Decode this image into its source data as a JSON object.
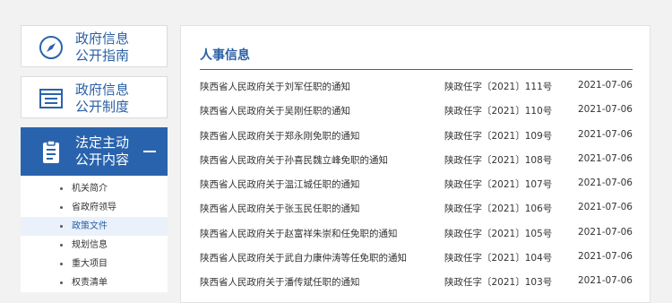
{
  "sidebar": {
    "cards": [
      {
        "line1": "政府信息",
        "line2": "公开指南",
        "icon": "compass-icon"
      },
      {
        "line1": "政府信息",
        "line2": "公开制度",
        "icon": "document-list-icon"
      },
      {
        "line1": "法定主动",
        "line2": "公开内容",
        "icon": "clipboard-icon"
      }
    ],
    "submenu": [
      "机关简介",
      "省政府领导",
      "政策文件",
      "规划信息",
      "重大项目",
      "权责清单"
    ]
  },
  "main": {
    "title": "人事信息",
    "rows": [
      {
        "title": "陕西省人民政府关于刘军任职的通知",
        "doc": "陕政任字〔2021〕111号",
        "date": "2021-07-06"
      },
      {
        "title": "陕西省人民政府关于吴刚任职的通知",
        "doc": "陕政任字〔2021〕110号",
        "date": "2021-07-06"
      },
      {
        "title": "陕西省人民政府关于郑永刚免职的通知",
        "doc": "陕政任字〔2021〕109号",
        "date": "2021-07-06"
      },
      {
        "title": "陕西省人民政府关于孙喜民魏立峰免职的通知",
        "doc": "陕政任字〔2021〕108号",
        "date": "2021-07-06"
      },
      {
        "title": "陕西省人民政府关于温江城任职的通知",
        "doc": "陕政任字〔2021〕107号",
        "date": "2021-07-06"
      },
      {
        "title": "陕西省人民政府关于张玉民任职的通知",
        "doc": "陕政任字〔2021〕106号",
        "date": "2021-07-06"
      },
      {
        "title": "陕西省人民政府关于赵富祥朱崇和任免职的通知",
        "doc": "陕政任字〔2021〕105号",
        "date": "2021-07-06"
      },
      {
        "title": "陕西省人民政府关于武自力康仲涛等任免职的通知",
        "doc": "陕政任字〔2021〕104号",
        "date": "2021-07-06"
      },
      {
        "title": "陕西省人民政府关于潘传斌任职的通知",
        "doc": "陕政任字〔2021〕103号",
        "date": "2021-07-06"
      }
    ]
  },
  "colors": {
    "accent": "#2a63ad",
    "link": "#2a5fa4",
    "background": "#f2f2f2"
  }
}
